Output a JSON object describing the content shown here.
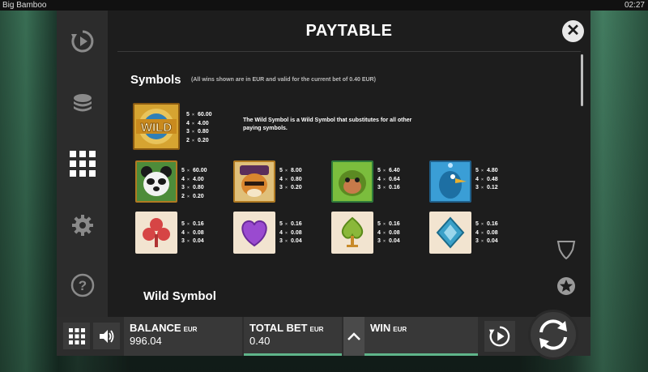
{
  "window": {
    "title": "Big Bamboo",
    "clock": "02:27"
  },
  "paytable": {
    "title": "PAYTABLE",
    "symbols_heading": "Symbols",
    "symbols_note": "(All wins shown are in EUR and valid for the current bet of 0.40 EUR)",
    "wild_description": "The Wild Symbol is a Wild Symbol that substitutes for all other paying symbols.",
    "wild_heading": "Wild Symbol",
    "wild": {
      "label": "WILD",
      "icon": "wild-symbol",
      "pays": [
        {
          "count": "5",
          "value": "60.00"
        },
        {
          "count": "4",
          "value": "4.00"
        },
        {
          "count": "3",
          "value": "0.80"
        },
        {
          "count": "2",
          "value": "0.20"
        }
      ]
    },
    "high_symbols": [
      {
        "icon": "panda-symbol",
        "pays": [
          {
            "count": "5",
            "value": "60.00"
          },
          {
            "count": "4",
            "value": "4.00"
          },
          {
            "count": "3",
            "value": "0.80"
          },
          {
            "count": "2",
            "value": "0.20"
          }
        ]
      },
      {
        "icon": "tiger-symbol",
        "pays": [
          {
            "count": "5",
            "value": "8.00"
          },
          {
            "count": "4",
            "value": "0.80"
          },
          {
            "count": "3",
            "value": "0.20"
          }
        ]
      },
      {
        "icon": "monkey-symbol",
        "pays": [
          {
            "count": "5",
            "value": "6.40"
          },
          {
            "count": "4",
            "value": "0.64"
          },
          {
            "count": "3",
            "value": "0.16"
          }
        ]
      },
      {
        "icon": "bird-symbol",
        "pays": [
          {
            "count": "5",
            "value": "4.80"
          },
          {
            "count": "4",
            "value": "0.48"
          },
          {
            "count": "3",
            "value": "0.12"
          }
        ]
      }
    ],
    "low_symbols": [
      {
        "icon": "club-symbol",
        "pays": [
          {
            "count": "5",
            "value": "0.16"
          },
          {
            "count": "4",
            "value": "0.08"
          },
          {
            "count": "3",
            "value": "0.04"
          }
        ]
      },
      {
        "icon": "heart-symbol",
        "pays": [
          {
            "count": "5",
            "value": "0.16"
          },
          {
            "count": "4",
            "value": "0.08"
          },
          {
            "count": "3",
            "value": "0.04"
          }
        ]
      },
      {
        "icon": "spade-symbol",
        "pays": [
          {
            "count": "5",
            "value": "0.16"
          },
          {
            "count": "4",
            "value": "0.08"
          },
          {
            "count": "3",
            "value": "0.04"
          }
        ]
      },
      {
        "icon": "diamond-symbol",
        "pays": [
          {
            "count": "5",
            "value": "0.16"
          },
          {
            "count": "4",
            "value": "0.08"
          },
          {
            "count": "3",
            "value": "0.04"
          }
        ]
      }
    ]
  },
  "bottombar": {
    "balance_label": "BALANCE",
    "balance_unit": "EUR",
    "balance_value": "996.04",
    "bet_label": "TOTAL BET",
    "bet_unit": "EUR",
    "bet_value": "0.40",
    "win_label": "WIN",
    "win_unit": "EUR"
  },
  "colors": {
    "accent": "#5fb58a",
    "panel": "#1d1d1d",
    "sidebar": "#2c2c2c"
  }
}
